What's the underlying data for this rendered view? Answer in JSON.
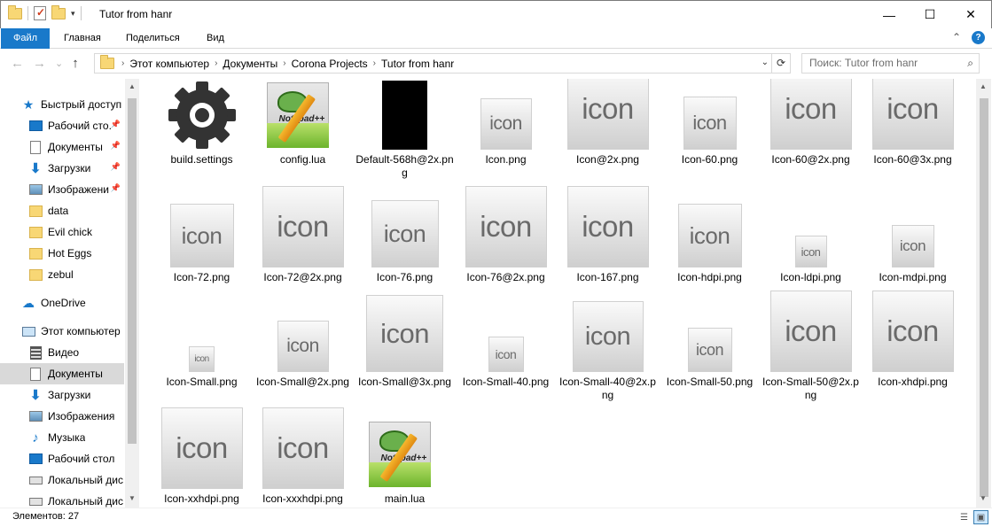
{
  "window": {
    "title": "Tutor from hanr",
    "minimize": "—",
    "maximize": "☐",
    "close": "✕"
  },
  "ribbon": {
    "tabs": [
      "Файл",
      "Главная",
      "Поделиться",
      "Вид"
    ],
    "collapse_glyph": "⌃",
    "help_glyph": "?"
  },
  "nav": {
    "back": "←",
    "forward": "→",
    "recent": "⌄",
    "up": "↑",
    "breadcrumb": [
      "Этот компьютер",
      "Документы",
      "Corona Projects",
      "Tutor from hanr"
    ],
    "crumb_sep": "›",
    "dropdown": "⌄",
    "refresh": "⟳",
    "search_placeholder": "Поиск: Tutor from hanr",
    "search_icon": "⌕"
  },
  "sidebar": {
    "items": [
      {
        "label": "Быстрый доступ",
        "icon": "star-icon",
        "glyph": "★"
      },
      {
        "label": "Рабочий сто.",
        "icon": "desktop-icon",
        "pinned": true
      },
      {
        "label": "Документы",
        "icon": "documents-icon",
        "pinned": true
      },
      {
        "label": "Загрузки",
        "icon": "downloads-icon",
        "glyph": "⬇",
        "pinned": true
      },
      {
        "label": "Изображени",
        "icon": "pictures-icon",
        "pinned": true
      },
      {
        "label": "data",
        "icon": "folder-icon"
      },
      {
        "label": "Evil chick",
        "icon": "folder-icon"
      },
      {
        "label": "Hot Eggs",
        "icon": "folder-icon"
      },
      {
        "label": "zebul",
        "icon": "folder-icon"
      },
      {
        "label": "OneDrive",
        "icon": "cloud-icon",
        "glyph": "☁"
      },
      {
        "label": "Этот компьютер",
        "icon": "computer-icon"
      },
      {
        "label": "Видео",
        "icon": "video-icon"
      },
      {
        "label": "Документы",
        "icon": "documents-icon"
      },
      {
        "label": "Загрузки",
        "icon": "downloads-icon",
        "glyph": "⬇"
      },
      {
        "label": "Изображения",
        "icon": "pictures-icon"
      },
      {
        "label": "Музыка",
        "icon": "music-icon",
        "glyph": "♪"
      },
      {
        "label": "Рабочий стол",
        "icon": "desktop-icon"
      },
      {
        "label": "Локальный дис",
        "icon": "drive-icon"
      },
      {
        "label": "Локальный дис",
        "icon": "drive-icon"
      }
    ],
    "pin_glyph": "📌"
  },
  "files": [
    {
      "name": "build.settings",
      "type": "gear"
    },
    {
      "name": "config.lua",
      "type": "notepad"
    },
    {
      "name": "Default-568h@2x.png",
      "type": "black"
    },
    {
      "name": "Icon.png",
      "type": "icon",
      "size": 58
    },
    {
      "name": "Icon@2x.png",
      "type": "icon",
      "size": 92
    },
    {
      "name": "Icon-60.png",
      "type": "icon",
      "size": 60
    },
    {
      "name": "Icon-60@2x.png",
      "type": "icon",
      "size": 92
    },
    {
      "name": "Icon-60@3x.png",
      "type": "icon",
      "size": 92
    },
    {
      "name": "Icon-72.png",
      "type": "icon",
      "size": 72
    },
    {
      "name": "Icon-72@2x.png",
      "type": "icon",
      "size": 92
    },
    {
      "name": "Icon-76.png",
      "type": "icon",
      "size": 76
    },
    {
      "name": "Icon-76@2x.png",
      "type": "icon",
      "size": 92
    },
    {
      "name": "Icon-167.png",
      "type": "icon",
      "size": 92
    },
    {
      "name": "Icon-hdpi.png",
      "type": "icon",
      "size": 72
    },
    {
      "name": "Icon-ldpi.png",
      "type": "icon",
      "size": 36
    },
    {
      "name": "Icon-mdpi.png",
      "type": "icon",
      "size": 48
    },
    {
      "name": "Icon-Small.png",
      "type": "icon",
      "size": 29
    },
    {
      "name": "Icon-Small@2x.png",
      "type": "icon",
      "size": 58
    },
    {
      "name": "Icon-Small@3x.png",
      "type": "icon",
      "size": 87
    },
    {
      "name": "Icon-Small-40.png",
      "type": "icon",
      "size": 40
    },
    {
      "name": "Icon-Small-40@2x.png",
      "type": "icon",
      "size": 80
    },
    {
      "name": "Icon-Small-50.png",
      "type": "icon",
      "size": 50
    },
    {
      "name": "Icon-Small-50@2x.png",
      "type": "icon",
      "size": 92
    },
    {
      "name": "Icon-xhdpi.png",
      "type": "icon",
      "size": 92
    },
    {
      "name": "Icon-xxhdpi.png",
      "type": "icon",
      "size": 92
    },
    {
      "name": "Icon-xxxhdpi.png",
      "type": "icon",
      "size": 92
    },
    {
      "name": "main.lua",
      "type": "notepad"
    }
  ],
  "icon_word": "icon",
  "notepad_word": "Notepad++",
  "status": {
    "count": "Элементов: 27"
  },
  "view": {
    "details_glyph": "☰",
    "large_icons_glyph": "▣"
  }
}
